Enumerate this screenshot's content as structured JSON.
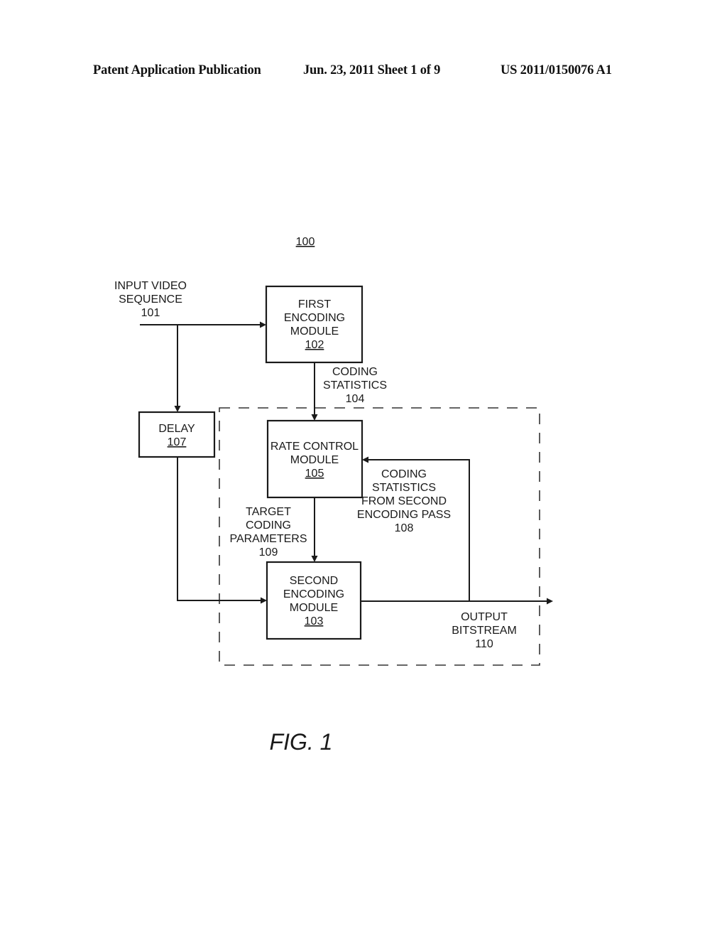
{
  "header": {
    "publication": "Patent Application Publication",
    "date_sheet": "Jun. 23, 2011  Sheet 1 of 9",
    "patent_number": "US 2011/0150076 A1"
  },
  "figure": {
    "ref": "100",
    "caption": "FIG. 1"
  },
  "nodes": {
    "first_encoding": {
      "lines": [
        "FIRST",
        "ENCODING",
        "MODULE"
      ],
      "ref": "102"
    },
    "rate_control": {
      "lines": [
        "RATE CONTROL",
        "MODULE"
      ],
      "ref": "105"
    },
    "second_encoding": {
      "lines": [
        "SECOND",
        "ENCODING",
        "MODULE"
      ],
      "ref": "103"
    },
    "delay": {
      "lines": [
        "DELAY"
      ],
      "ref": "107"
    }
  },
  "signals": {
    "input": {
      "lines": [
        "INPUT VIDEO",
        "SEQUENCE"
      ],
      "ref": "101"
    },
    "coding_stats": {
      "lines": [
        "CODING",
        "STATISTICS"
      ],
      "ref": "104"
    },
    "feedback_stats": {
      "lines": [
        "CODING",
        "STATISTICS",
        "FROM SECOND",
        "ENCODING PASS"
      ],
      "ref": "108"
    },
    "target_params": {
      "lines": [
        "TARGET",
        "CODING",
        "PARAMETERS"
      ],
      "ref": "109"
    },
    "output": {
      "lines": [
        "OUTPUT",
        "BITSTREAM"
      ],
      "ref": "110"
    }
  }
}
